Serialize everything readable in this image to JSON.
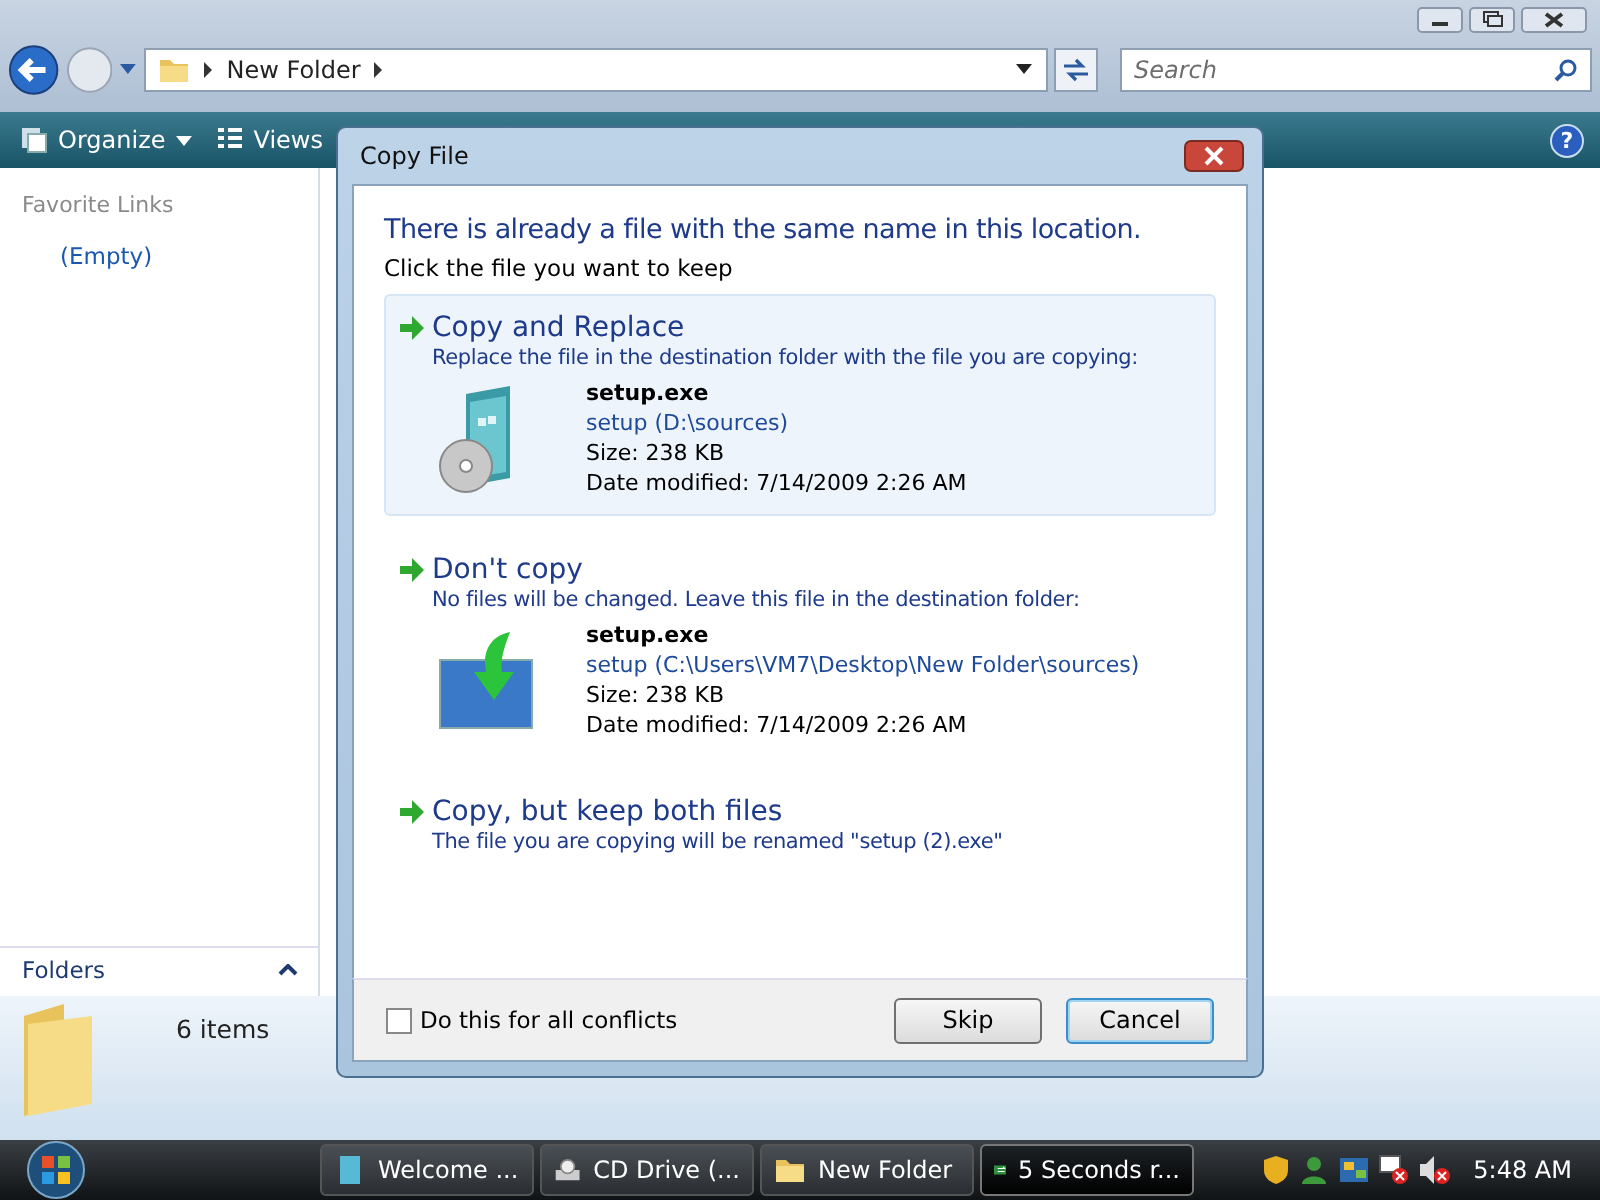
{
  "explorer": {
    "address_path": "New Folder",
    "search": {
      "placeholder": "Search"
    },
    "toolbar": [
      {
        "label": "Organize",
        "dropdown": true
      },
      {
        "label": "Views",
        "dropdown": false
      }
    ],
    "help_label": "?",
    "favorite_links": {
      "title": "Favorite Links",
      "items": [
        "(Empty)"
      ]
    },
    "folders_label": "Folders",
    "details": {
      "count": "6 items"
    }
  },
  "dialog": {
    "title": "Copy File",
    "heading": "There is already a file with the same name in this location.",
    "instruction": "Click the file you want to keep",
    "options": [
      {
        "title": "Copy and Replace",
        "description": "Replace the file in the destination folder with the file you are copying:",
        "hovered": true,
        "file": {
          "kind": "disc-box",
          "name": "setup.exe",
          "location": "setup (D:\\sources)",
          "size": "Size: 238 KB",
          "modified": "Date modified: 7/14/2009 2:26 AM"
        }
      },
      {
        "title": "Don't copy",
        "description": "No files will be changed. Leave this file in the destination folder:",
        "hovered": false,
        "file": {
          "kind": "monitor",
          "name": "setup.exe",
          "location": "setup (C:\\Users\\VM7\\Desktop\\New Folder\\sources)",
          "size": "Size: 238 KB",
          "modified": "Date modified: 7/14/2009 2:26 AM"
        }
      },
      {
        "title": "Copy, but keep both files",
        "description": "The file you are copying will be renamed \"setup (2).exe\"",
        "hovered": false
      }
    ],
    "checkbox": {
      "label": "Do this for all conflicts",
      "checked": false
    },
    "buttons": [
      {
        "label": "Skip",
        "default": false
      },
      {
        "label": "Cancel",
        "default": true
      }
    ]
  },
  "taskbar": {
    "tasks": [
      {
        "label": "Welcome ...",
        "kind": "document",
        "selected": false
      },
      {
        "label": "CD Drive (...",
        "kind": "drive",
        "selected": false
      },
      {
        "label": "New Folder",
        "kind": "folder",
        "selected": false
      },
      {
        "label": "5 Seconds r...",
        "kind": "copy",
        "selected": true
      }
    ],
    "clock": "5:48 AM"
  }
}
